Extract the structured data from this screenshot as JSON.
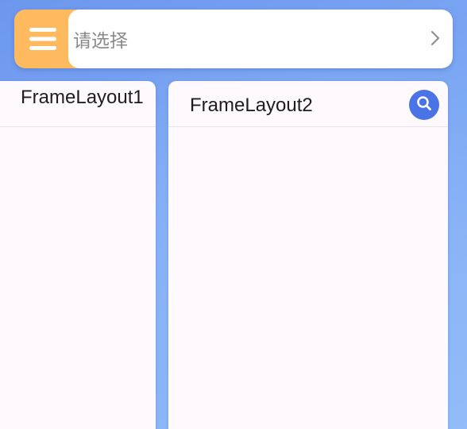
{
  "selector": {
    "menu_icon": "menu-icon",
    "placeholder": "请选择",
    "chevron_icon": "chevron-right-icon"
  },
  "panels": [
    {
      "title": "FrameLayout1"
    },
    {
      "title": "FrameLayout2",
      "action_icon": "search-icon"
    }
  ],
  "colors": {
    "menu_button": "#ffb95f",
    "search_button": "#4a73e6",
    "background": "#7ea9f4"
  }
}
